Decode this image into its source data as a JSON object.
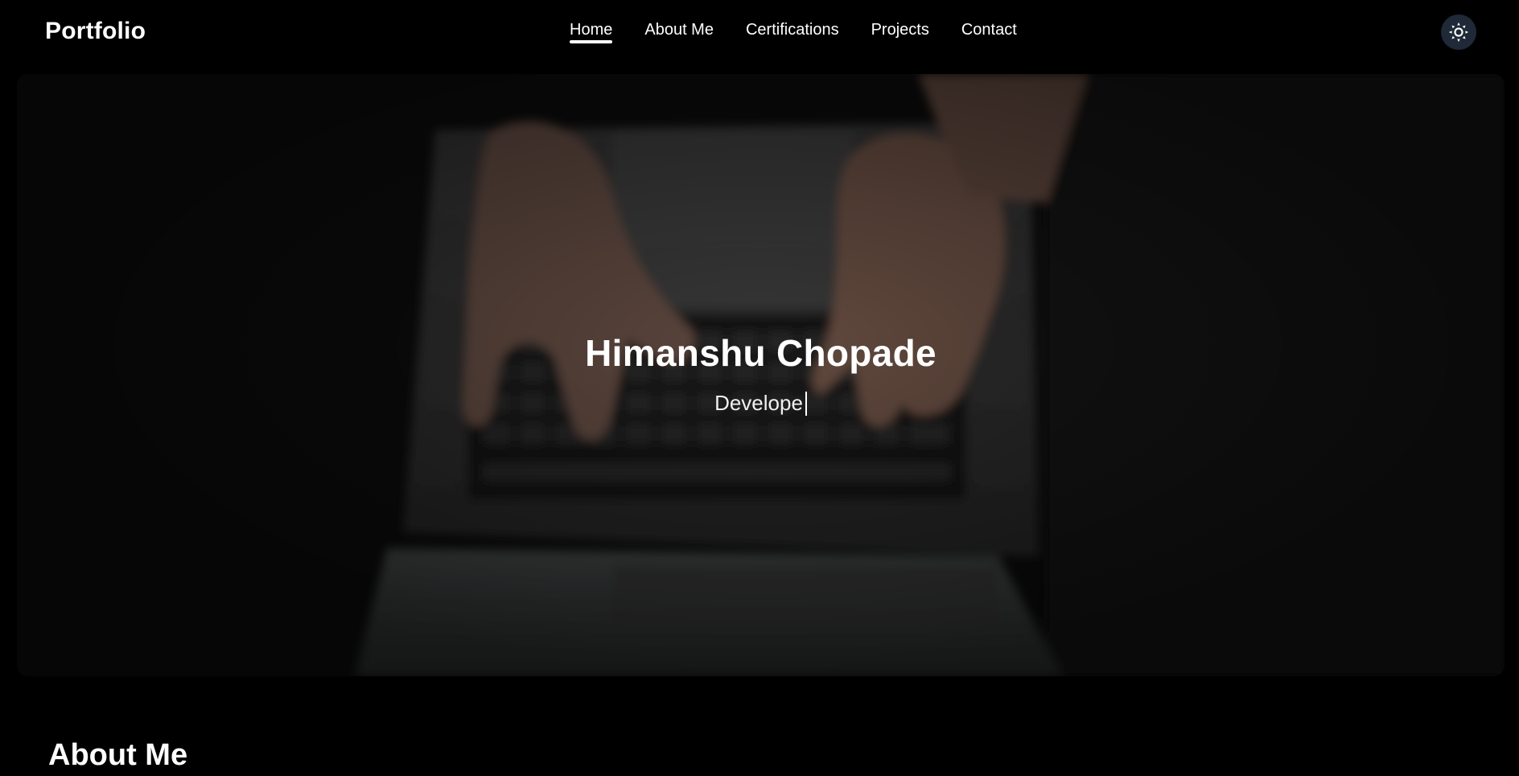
{
  "navbar": {
    "brand": "Portfolio",
    "links": [
      {
        "label": "Home",
        "active": true
      },
      {
        "label": "About Me",
        "active": false
      },
      {
        "label": "Certifications",
        "active": false
      },
      {
        "label": "Projects",
        "active": false
      },
      {
        "label": "Contact",
        "active": false
      }
    ],
    "theme_toggle_icon": "sun-icon"
  },
  "hero": {
    "name": "Himanshu Chopade",
    "role_typed": "Develope",
    "background_image": "laptop-typing-photo"
  },
  "about": {
    "heading": "About Me"
  },
  "colors": {
    "background": "#000000",
    "text": "#ffffff",
    "toggle_bg": "#1f2937"
  }
}
